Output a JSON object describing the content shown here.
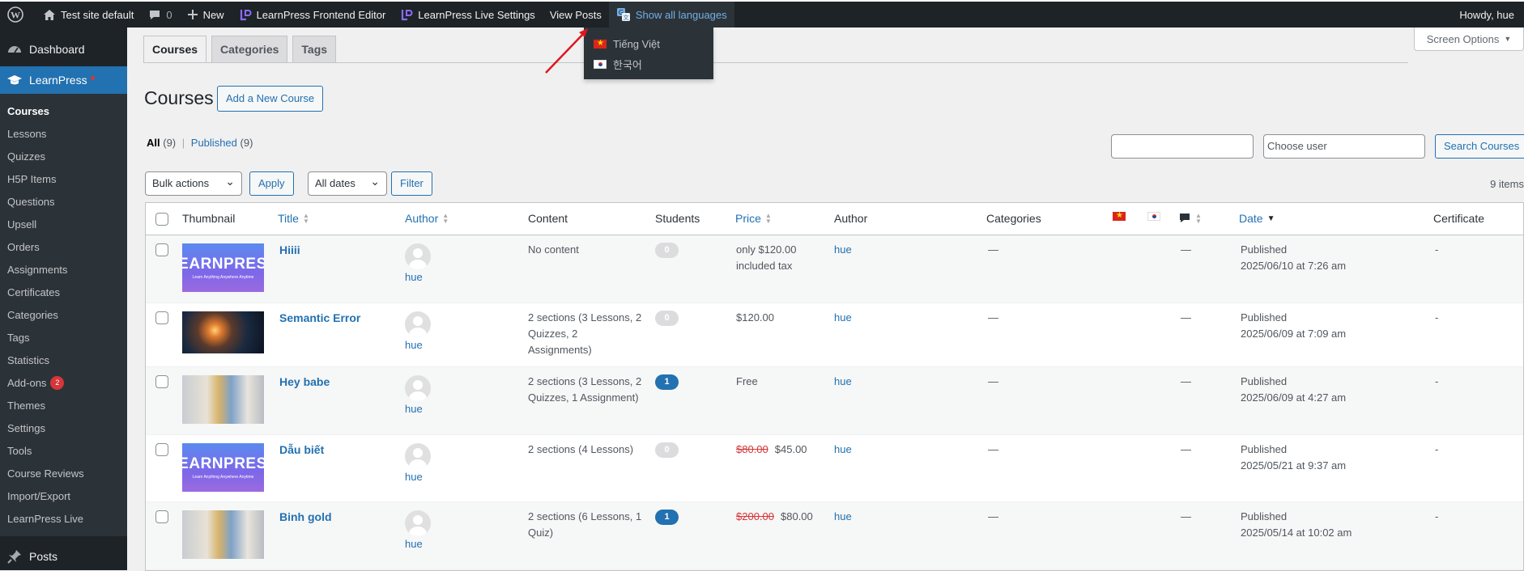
{
  "adminbar": {
    "site_name": "Test site default",
    "comments_count": "0",
    "new_label": "New",
    "lp_frontend_editor": "LearnPress Frontend Editor",
    "lp_live_settings": "LearnPress Live Settings",
    "view_posts": "View Posts",
    "show_all_languages": "Show all languages",
    "howdy": "Howdy, hue"
  },
  "lang_menu": [
    "Tiếng Việt",
    "한국어"
  ],
  "sidebar": {
    "dashboard": "Dashboard",
    "learnpress": "LearnPress",
    "items": [
      "Courses",
      "Lessons",
      "Quizzes",
      "H5P Items",
      "Questions",
      "Upsell",
      "Orders",
      "Assignments",
      "Certificates",
      "Categories",
      "Tags",
      "Statistics",
      "Add-ons",
      "Themes",
      "Settings",
      "Tools",
      "Course Reviews",
      "Import/Export",
      "LearnPress Live"
    ],
    "addons_badge": "2",
    "posts": "Posts"
  },
  "tabs": [
    "Courses",
    "Categories",
    "Tags"
  ],
  "screen_options": "Screen Options",
  "page": {
    "title": "Courses",
    "add_new": "Add a New Course",
    "filter_all": "All",
    "filter_all_count": "(9)",
    "filter_published": "Published",
    "filter_published_count": "(9)",
    "search_placeholder_user": "Choose user",
    "search_button": "Search Courses",
    "bulk_actions": "Bulk actions",
    "apply": "Apply",
    "all_dates": "All dates",
    "filter": "Filter",
    "items_count": "9 items"
  },
  "table": {
    "headers": {
      "thumbnail": "Thumbnail",
      "title": "Title",
      "author": "Author",
      "content": "Content",
      "students": "Students",
      "price": "Price",
      "author2": "Author",
      "categories": "Categories",
      "date": "Date",
      "certificate": "Certificate"
    },
    "rows": [
      {
        "title": "Hiiii",
        "author": "hue",
        "content_l1": "No content",
        "content_l2": "",
        "content_l3": "",
        "students": "0",
        "price_old": "",
        "price_l1": "only $120.00",
        "price_l2": "included tax",
        "author2": "hue",
        "categories": "—",
        "comments": "—",
        "status": "Published",
        "date": "2025/06/10 at 7:26 am",
        "certificate": "-"
      },
      {
        "title": "Semantic Error",
        "author": "hue",
        "content_l1": "2 sections (3 Lessons, 2",
        "content_l2": "Quizzes, 2",
        "content_l3": "Assignments)",
        "students": "0",
        "price_old": "",
        "price_l1": "$120.00",
        "price_l2": "",
        "author2": "hue",
        "categories": "—",
        "comments": "—",
        "status": "Published",
        "date": "2025/06/09 at 7:09 am",
        "certificate": "-"
      },
      {
        "title": "Hey babe",
        "author": "hue",
        "content_l1": "2 sections (3 Lessons, 2",
        "content_l2": "Quizzes, 1 Assignment)",
        "content_l3": "",
        "students": "1",
        "price_old": "",
        "price_l1": "Free",
        "price_l2": "",
        "author2": "hue",
        "categories": "—",
        "comments": "—",
        "status": "Published",
        "date": "2025/06/09 at 4:27 am",
        "certificate": "-"
      },
      {
        "title": "Dẫu biết",
        "author": "hue",
        "content_l1": "2 sections (4 Lessons)",
        "content_l2": "",
        "content_l3": "",
        "students": "0",
        "price_old": "$80.00",
        "price_l1": "$45.00",
        "price_l2": "",
        "author2": "hue",
        "categories": "—",
        "comments": "—",
        "status": "Published",
        "date": "2025/05/21 at 9:37 am",
        "certificate": "-"
      },
      {
        "title": "Binh gold",
        "author": "hue",
        "content_l1": "2 sections (6 Lessons, 1",
        "content_l2": "Quiz)",
        "content_l3": "",
        "students": "1",
        "price_old": "$200.00",
        "price_l1": "$80.00",
        "price_l2": "",
        "author2": "hue",
        "categories": "—",
        "comments": "—",
        "status": "Published",
        "date": "2025/05/14 at 10:02 am",
        "certificate": "-"
      }
    ],
    "thumb_text": "LEARNPRESS",
    "thumb_subtext": "Learn Anything Anywhere Anytime"
  },
  "colors": {
    "adminbar": "#1d2327",
    "accent": "#2271b1",
    "annotation_arrow": "#e0161e"
  }
}
